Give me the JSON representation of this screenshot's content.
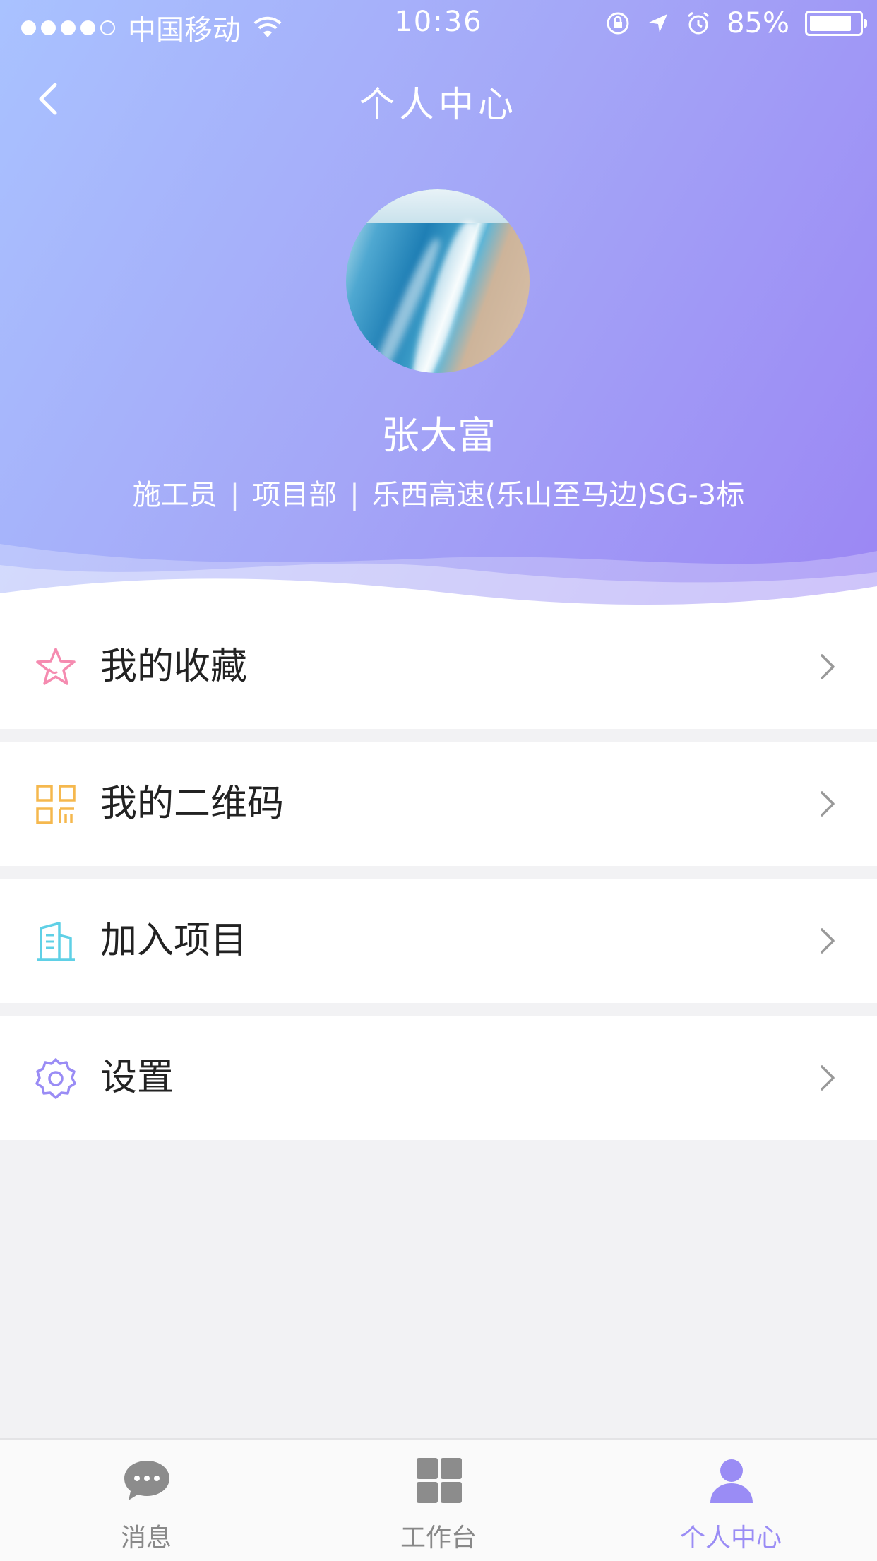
{
  "status_bar": {
    "carrier": "中国移动",
    "time": "10:36",
    "battery": "85%",
    "battery_level": 0.85
  },
  "nav": {
    "title": "个人中心"
  },
  "profile": {
    "name": "张大富",
    "role": "施工员",
    "department": "项目部",
    "project": "乐西高速(乐山至马边)SG-3标",
    "separator": "|"
  },
  "menu": {
    "items": [
      {
        "label": "我的收藏",
        "icon": "star-icon",
        "color": "#f58bb0"
      },
      {
        "label": "我的二维码",
        "icon": "qr-code-icon",
        "color": "#f5b84e"
      },
      {
        "label": "加入项目",
        "icon": "building-icon",
        "color": "#5fd0e6"
      },
      {
        "label": "设置",
        "icon": "gear-icon",
        "color": "#9a8cf5"
      }
    ]
  },
  "tabs": [
    {
      "label": "消息",
      "icon": "chat-bubble-icon",
      "active": false
    },
    {
      "label": "工作台",
      "icon": "grid-icon",
      "active": false
    },
    {
      "label": "个人中心",
      "icon": "person-icon",
      "active": true
    }
  ],
  "colors": {
    "accent": "#9a8cf5",
    "gradient_start": "#a9c2ff",
    "gradient_end": "#9b86f4",
    "inactive": "#888888"
  }
}
